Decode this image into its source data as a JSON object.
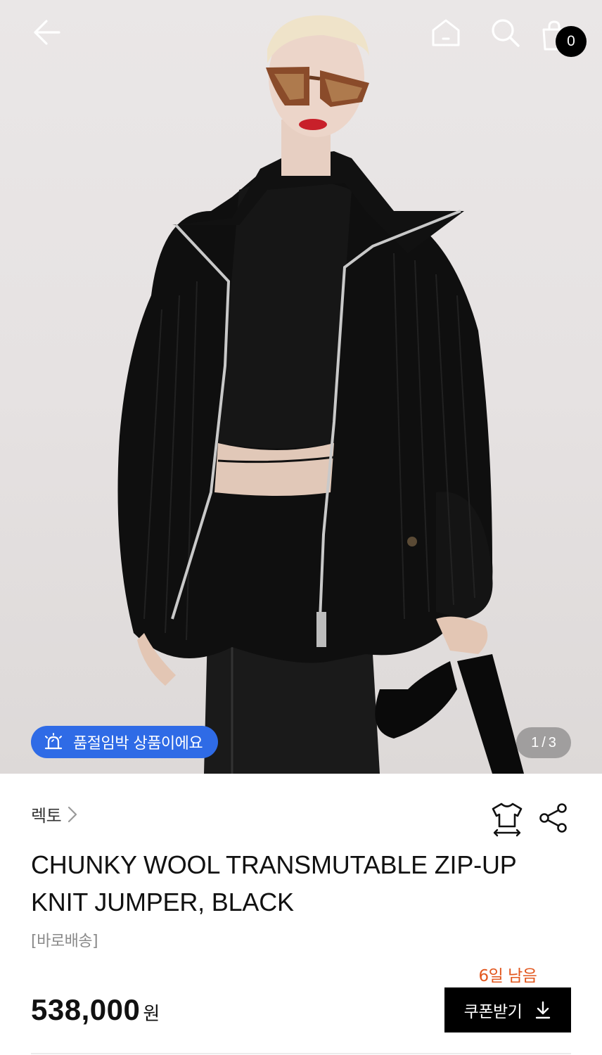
{
  "header": {
    "back_icon": "arrow-left-icon",
    "home_icon": "home-icon",
    "search_icon": "search-icon",
    "cart_icon": "shopping-bag-icon",
    "cart_count": "0"
  },
  "gallery": {
    "soldout_badge": "품절임박 상품이에요",
    "soldout_icon": "siren-icon",
    "badge_color": "#2f6be6",
    "pager": {
      "current": "1",
      "separator": "/",
      "total": "3"
    }
  },
  "product": {
    "brand": "렉토",
    "brand_chevron_icon": "chevron-right-icon",
    "fit_icon": "size-guide-shirt-icon",
    "share_icon": "share-icon",
    "title": "CHUNKY WOOL TRANSMUTABLE ZIP-UP KNIT JUMPER, BLACK",
    "delivery_tag": "[바로배송]",
    "price": "538,000",
    "currency": "원",
    "coupon_days_left": "6일 남음",
    "coupon_days_color": "#e2571e",
    "coupon_button": "쿠폰받기",
    "coupon_icon": "download-icon"
  }
}
